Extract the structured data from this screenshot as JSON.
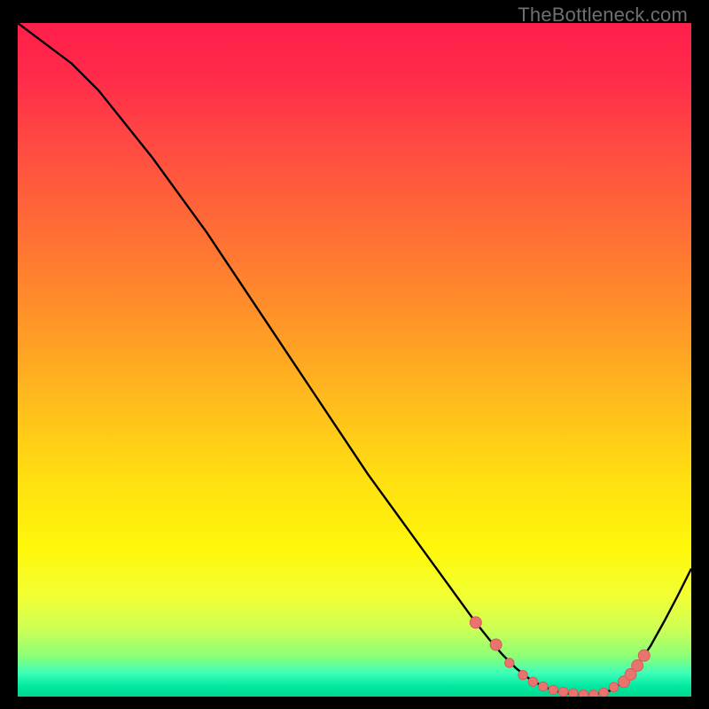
{
  "watermark": "TheBottleneck.com",
  "colors": {
    "bg": "#000000",
    "curve": "#000000",
    "marker_fill": "#e9736f",
    "marker_stroke": "#d95b57",
    "gradient_stops": [
      {
        "offset": 0.0,
        "color": "#ff1f4b"
      },
      {
        "offset": 0.08,
        "color": "#ff2b4a"
      },
      {
        "offset": 0.18,
        "color": "#ff4a42"
      },
      {
        "offset": 0.3,
        "color": "#ff6b36"
      },
      {
        "offset": 0.42,
        "color": "#ff8e2a"
      },
      {
        "offset": 0.55,
        "color": "#ffb81e"
      },
      {
        "offset": 0.68,
        "color": "#ffe011"
      },
      {
        "offset": 0.78,
        "color": "#fff70a"
      },
      {
        "offset": 0.85,
        "color": "#f2ff33"
      },
      {
        "offset": 0.9,
        "color": "#cdff55"
      },
      {
        "offset": 0.94,
        "color": "#8bff77"
      },
      {
        "offset": 0.965,
        "color": "#3dffb9"
      },
      {
        "offset": 0.985,
        "color": "#00e8a0"
      },
      {
        "offset": 1.0,
        "color": "#00d88f"
      }
    ]
  },
  "chart_data": {
    "type": "line",
    "title": "",
    "xlabel": "",
    "ylabel": "",
    "xlim": [
      0,
      100
    ],
    "ylim": [
      0,
      100
    ],
    "series": [
      {
        "name": "bottleneck-curve",
        "x": [
          0,
          4,
          8,
          12,
          16,
          20,
          24,
          28,
          32,
          36,
          40,
          44,
          48,
          52,
          56,
          60,
          64,
          68,
          70,
          72,
          74,
          76,
          78,
          80,
          82,
          84,
          86,
          88,
          90,
          92,
          94,
          96,
          98,
          100
        ],
        "y": [
          100,
          97,
          94,
          90,
          85,
          80,
          74.5,
          69,
          63,
          57,
          51,
          45,
          39,
          33,
          27.5,
          22,
          16.5,
          11,
          8.5,
          6.2,
          4.2,
          2.6,
          1.5,
          0.8,
          0.4,
          0.3,
          0.4,
          0.9,
          2.2,
          4.6,
          7.6,
          11.2,
          15.0,
          19.0
        ]
      }
    ],
    "markers": {
      "name": "highlighted-points",
      "x": [
        68,
        71,
        73,
        75,
        76.5,
        78,
        79.5,
        81,
        82.5,
        84,
        85.5,
        87,
        88.5,
        90,
        91,
        92,
        93
      ],
      "y": [
        11.0,
        7.7,
        5.0,
        3.2,
        2.2,
        1.5,
        1.0,
        0.7,
        0.5,
        0.3,
        0.3,
        0.6,
        1.4,
        2.2,
        3.3,
        4.6,
        6.1
      ]
    }
  }
}
